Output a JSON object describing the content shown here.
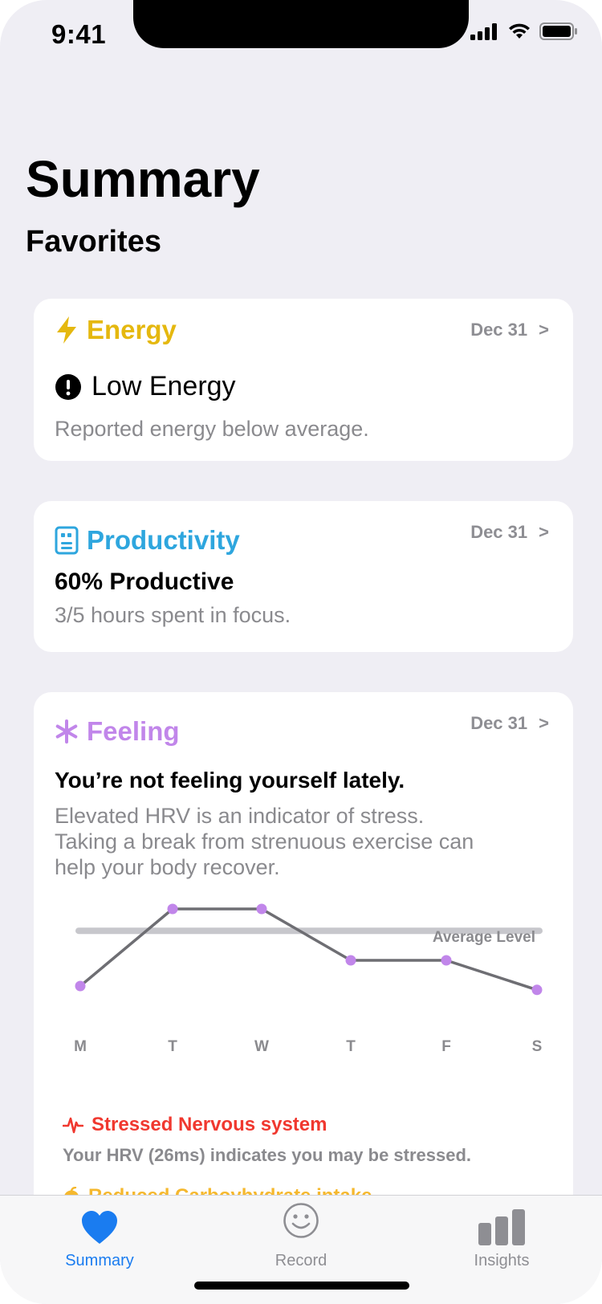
{
  "status": {
    "time": "9:41"
  },
  "page": {
    "title": "Summary",
    "section": "Favorites"
  },
  "cards": {
    "energy": {
      "title": "Energy",
      "date": "Dec 31",
      "chevron": ">",
      "headline": "Low Energy",
      "subtext": "Reported energy below average.",
      "color": "#e5b80f",
      "icon": "bolt-icon"
    },
    "productivity": {
      "title": "Productivity",
      "date": "Dec 31",
      "chevron": ">",
      "headline": "60% Productive",
      "subtext": "3/5 hours spent in focus.",
      "color": "#2ea6de",
      "icon": "document-icon"
    },
    "feeling": {
      "title": "Feeling",
      "date": "Dec 31",
      "chevron": ">",
      "headline": "You’re not feeling yourself lately.",
      "subtext_lines": [
        "Elevated HRV is an indicator of stress.",
        "Taking a break from strenuous exercise can",
        "help your body recover."
      ],
      "color": "#c186ea",
      "icon": "asterisk-icon"
    }
  },
  "chart_data": {
    "type": "line",
    "categories": [
      "M",
      "T",
      "W",
      "T",
      "F",
      "S"
    ],
    "series": [
      {
        "values": [
          1,
          4,
          4,
          2,
          2,
          0.85
        ]
      }
    ],
    "reference_line": {
      "label": "Average Level",
      "value": 3.15
    },
    "ylim": [
      0,
      5
    ],
    "grid": false,
    "line_color": "#6e6e73",
    "point_color": "#c186ea",
    "avg_color": "#c7c7cc"
  },
  "alerts": [
    {
      "title": "Stressed Nervous system",
      "text": "Your HRV (26ms) indicates you may be stressed.",
      "color": "#f0382f",
      "icon": "heartbeat-icon"
    },
    {
      "title": "Reduced Carboyhydrate intake",
      "color": "#f5b82e",
      "icon": "fruit-icon"
    }
  ],
  "tabs": [
    {
      "label": "Summary",
      "icon": "heart-icon",
      "active": true,
      "color": "#1a7cf0"
    },
    {
      "label": "Record",
      "icon": "smiley-icon",
      "active": false,
      "color": "#8e8e93"
    },
    {
      "label": "Insights",
      "icon": "bar-chart-icon",
      "active": false,
      "color": "#8e8e93"
    }
  ]
}
